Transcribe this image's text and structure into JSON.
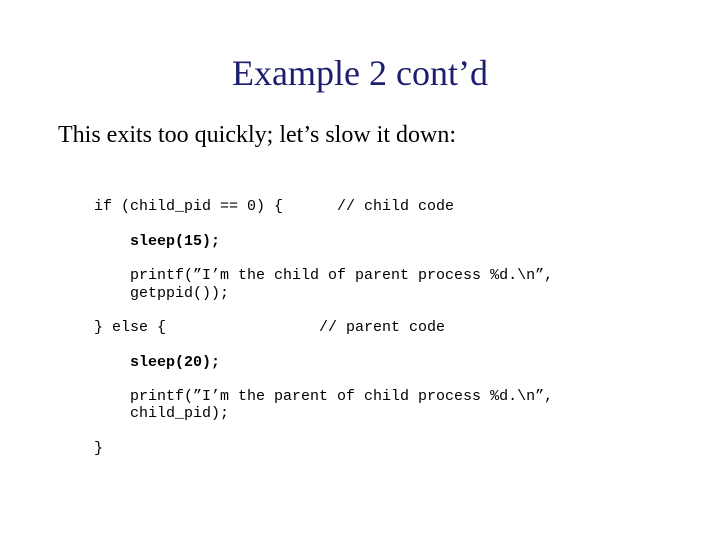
{
  "title": "Example 2 cont’d",
  "subtitle": "This exits too quickly; let’s slow it down:",
  "code": {
    "l1a": "if (child_pid == 0) {",
    "l1b": "      // child code",
    "l2": "    sleep(15);",
    "l3": "    printf(”I’m the child of parent process %d.\\n”,\n    getppid());",
    "l4a": "} else {",
    "l4b": "                 // parent code",
    "l5": "    sleep(20);",
    "l6": "    printf(”I’m the parent of child process %d.\\n”,\n    child_pid);",
    "l7": "}"
  }
}
